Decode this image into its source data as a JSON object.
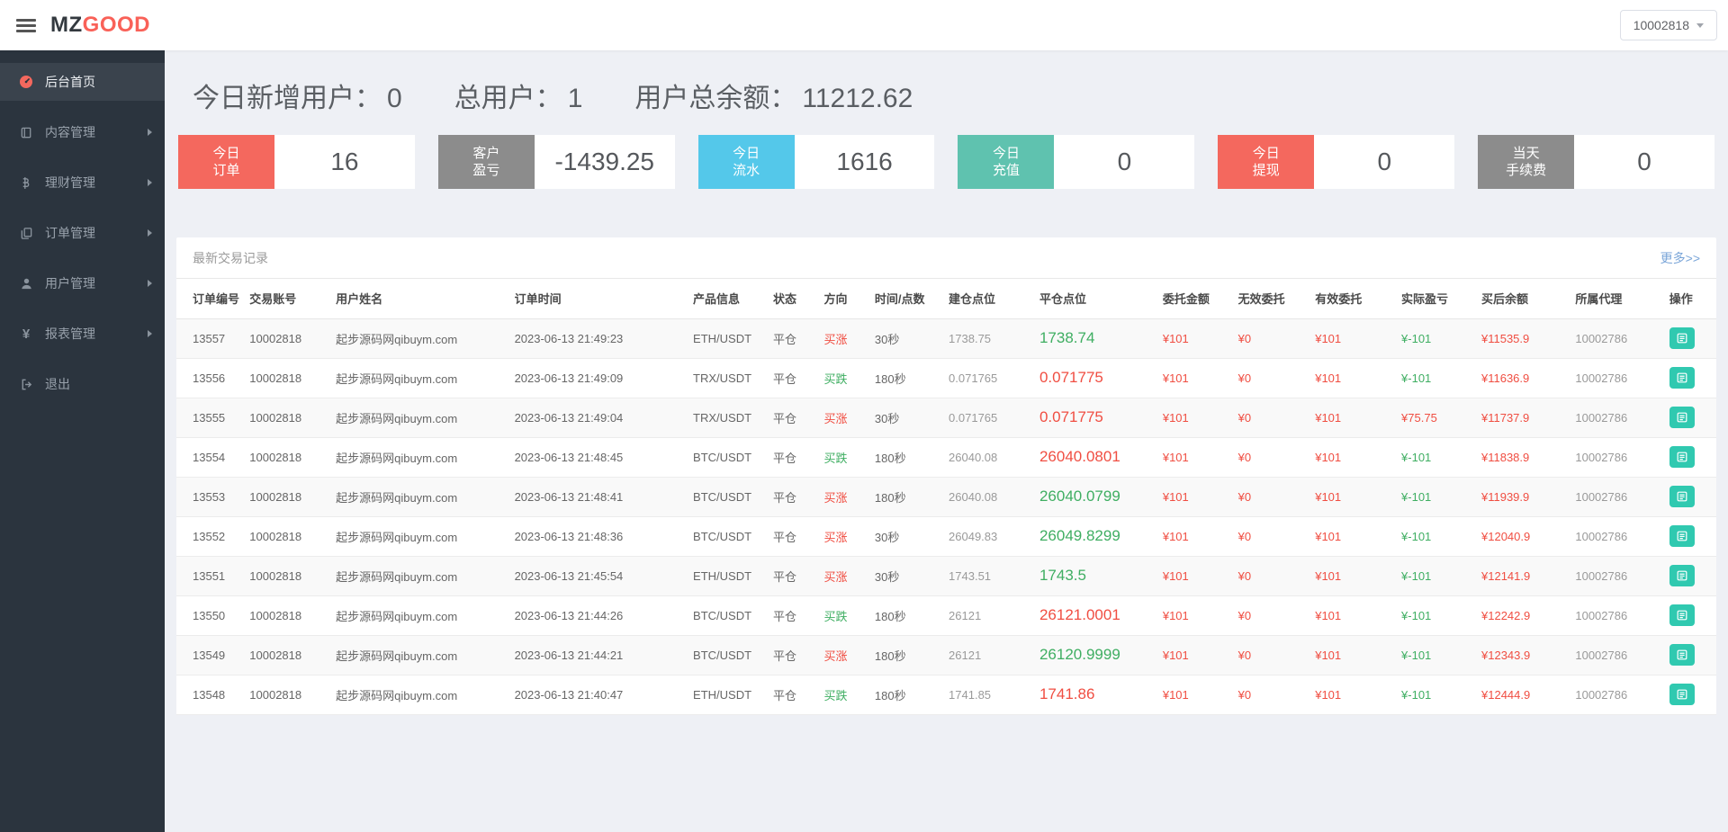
{
  "colors": {
    "brand_red": "#f96158",
    "card_red": "#f4685e",
    "card_gray": "#8c8c8c",
    "card_blue": "#54c8ea",
    "card_teal": "#5fc2af",
    "text_red": "#f04e42",
    "text_green": "#3fae62",
    "link_blue": "#7aa5d8",
    "action_teal": "#30c9b0",
    "sidebar_bg": "#2b343e"
  },
  "topbar": {
    "menu_icon": "menu-icon",
    "logo_prefix": "MZ",
    "logo_suffix": "GOOD",
    "account": "10002818",
    "account_caret_icon": "chevron-down-icon"
  },
  "sidebar": {
    "items": [
      {
        "name": "home",
        "label": "后台首页",
        "icon": "dashboard-icon",
        "active": true,
        "arrow": false
      },
      {
        "name": "content",
        "label": "内容管理",
        "icon": "book-icon",
        "active": false,
        "arrow": true
      },
      {
        "name": "finance",
        "label": "理财管理",
        "icon": "bitcoin-icon",
        "active": false,
        "arrow": true
      },
      {
        "name": "orders",
        "label": "订单管理",
        "icon": "copy-icon",
        "active": false,
        "arrow": true
      },
      {
        "name": "users",
        "label": "用户管理",
        "icon": "user-icon",
        "active": false,
        "arrow": true
      },
      {
        "name": "reports",
        "label": "报表管理",
        "icon": "yen-icon",
        "active": false,
        "arrow": true
      },
      {
        "name": "logout",
        "label": "退出",
        "icon": "logout-icon",
        "active": false,
        "arrow": false
      }
    ]
  },
  "summary": [
    {
      "label": "今日新增用户：",
      "value": "0"
    },
    {
      "label": "总用户：",
      "value": "1"
    },
    {
      "label": "用户总余额：",
      "value": "11212.62"
    }
  ],
  "cards": [
    {
      "lines": [
        "今日",
        "订单"
      ],
      "value": "16",
      "color": "#f4685e"
    },
    {
      "lines": [
        "客户",
        "盈亏"
      ],
      "value": "-1439.25",
      "color": "#8c8c8c"
    },
    {
      "lines": [
        "今日",
        "流水"
      ],
      "value": "1616",
      "color": "#54c8ea"
    },
    {
      "lines": [
        "今日",
        "充值"
      ],
      "value": "0",
      "color": "#5fc2af"
    },
    {
      "lines": [
        "今日",
        "提现"
      ],
      "value": "0",
      "color": "#f4685e"
    },
    {
      "lines": [
        "当天",
        "手续费"
      ],
      "value": "0",
      "color": "#8c8c8c"
    }
  ],
  "panel": {
    "title": "最新交易记录",
    "more_link": "更多>>"
  },
  "table": {
    "columns": [
      "订单编号",
      "交易账号",
      "用户姓名",
      "订单时间",
      "产品信息",
      "状态",
      "方向",
      "时间/点数",
      "建仓点位",
      "平仓点位",
      "委托金额",
      "无效委托",
      "有效委托",
      "实际盈亏",
      "买后余额",
      "所属代理",
      "操作"
    ],
    "action_icon": "list-icon",
    "rows": [
      {
        "order_no": "13557",
        "account": "10002818",
        "username": "起步源码网qibuym.com",
        "time": "2023-06-13 21:49:23",
        "product": "ETH/USDT",
        "status": "平仓",
        "direction": "买涨",
        "direction_color": "red",
        "duration": "30秒",
        "open_point": "1738.75",
        "close_point": "1738.74",
        "close_color": "green",
        "entrust": "¥101",
        "invalid": "¥0",
        "valid": "¥101",
        "profit": "¥-101",
        "profit_color": "green",
        "balance": "¥11535.9",
        "agent": "10002786"
      },
      {
        "order_no": "13556",
        "account": "10002818",
        "username": "起步源码网qibuym.com",
        "time": "2023-06-13 21:49:09",
        "product": "TRX/USDT",
        "status": "平仓",
        "direction": "买跌",
        "direction_color": "green",
        "duration": "180秒",
        "open_point": "0.071765",
        "close_point": "0.071775",
        "close_color": "red",
        "entrust": "¥101",
        "invalid": "¥0",
        "valid": "¥101",
        "profit": "¥-101",
        "profit_color": "green",
        "balance": "¥11636.9",
        "agent": "10002786"
      },
      {
        "order_no": "13555",
        "account": "10002818",
        "username": "起步源码网qibuym.com",
        "time": "2023-06-13 21:49:04",
        "product": "TRX/USDT",
        "status": "平仓",
        "direction": "买涨",
        "direction_color": "red",
        "duration": "30秒",
        "open_point": "0.071765",
        "close_point": "0.071775",
        "close_color": "red",
        "entrust": "¥101",
        "invalid": "¥0",
        "valid": "¥101",
        "profit": "¥75.75",
        "profit_color": "red",
        "balance": "¥11737.9",
        "agent": "10002786"
      },
      {
        "order_no": "13554",
        "account": "10002818",
        "username": "起步源码网qibuym.com",
        "time": "2023-06-13 21:48:45",
        "product": "BTC/USDT",
        "status": "平仓",
        "direction": "买跌",
        "direction_color": "green",
        "duration": "180秒",
        "open_point": "26040.08",
        "close_point": "26040.0801",
        "close_color": "red",
        "entrust": "¥101",
        "invalid": "¥0",
        "valid": "¥101",
        "profit": "¥-101",
        "profit_color": "green",
        "balance": "¥11838.9",
        "agent": "10002786"
      },
      {
        "order_no": "13553",
        "account": "10002818",
        "username": "起步源码网qibuym.com",
        "time": "2023-06-13 21:48:41",
        "product": "BTC/USDT",
        "status": "平仓",
        "direction": "买涨",
        "direction_color": "red",
        "duration": "180秒",
        "open_point": "26040.08",
        "close_point": "26040.0799",
        "close_color": "green",
        "entrust": "¥101",
        "invalid": "¥0",
        "valid": "¥101",
        "profit": "¥-101",
        "profit_color": "green",
        "balance": "¥11939.9",
        "agent": "10002786"
      },
      {
        "order_no": "13552",
        "account": "10002818",
        "username": "起步源码网qibuym.com",
        "time": "2023-06-13 21:48:36",
        "product": "BTC/USDT",
        "status": "平仓",
        "direction": "买涨",
        "direction_color": "red",
        "duration": "30秒",
        "open_point": "26049.83",
        "close_point": "26049.8299",
        "close_color": "green",
        "entrust": "¥101",
        "invalid": "¥0",
        "valid": "¥101",
        "profit": "¥-101",
        "profit_color": "green",
        "balance": "¥12040.9",
        "agent": "10002786"
      },
      {
        "order_no": "13551",
        "account": "10002818",
        "username": "起步源码网qibuym.com",
        "time": "2023-06-13 21:45:54",
        "product": "ETH/USDT",
        "status": "平仓",
        "direction": "买涨",
        "direction_color": "red",
        "duration": "30秒",
        "open_point": "1743.51",
        "close_point": "1743.5",
        "close_color": "green",
        "entrust": "¥101",
        "invalid": "¥0",
        "valid": "¥101",
        "profit": "¥-101",
        "profit_color": "green",
        "balance": "¥12141.9",
        "agent": "10002786"
      },
      {
        "order_no": "13550",
        "account": "10002818",
        "username": "起步源码网qibuym.com",
        "time": "2023-06-13 21:44:26",
        "product": "BTC/USDT",
        "status": "平仓",
        "direction": "买跌",
        "direction_color": "green",
        "duration": "180秒",
        "open_point": "26121",
        "close_point": "26121.0001",
        "close_color": "red",
        "entrust": "¥101",
        "invalid": "¥0",
        "valid": "¥101",
        "profit": "¥-101",
        "profit_color": "green",
        "balance": "¥12242.9",
        "agent": "10002786"
      },
      {
        "order_no": "13549",
        "account": "10002818",
        "username": "起步源码网qibuym.com",
        "time": "2023-06-13 21:44:21",
        "product": "BTC/USDT",
        "status": "平仓",
        "direction": "买涨",
        "direction_color": "red",
        "duration": "180秒",
        "open_point": "26121",
        "close_point": "26120.9999",
        "close_color": "green",
        "entrust": "¥101",
        "invalid": "¥0",
        "valid": "¥101",
        "profit": "¥-101",
        "profit_color": "green",
        "balance": "¥12343.9",
        "agent": "10002786"
      },
      {
        "order_no": "13548",
        "account": "10002818",
        "username": "起步源码网qibuym.com",
        "time": "2023-06-13 21:40:47",
        "product": "ETH/USDT",
        "status": "平仓",
        "direction": "买跌",
        "direction_color": "green",
        "duration": "180秒",
        "open_point": "1741.85",
        "close_point": "1741.86",
        "close_color": "red",
        "entrust": "¥101",
        "invalid": "¥0",
        "valid": "¥101",
        "profit": "¥-101",
        "profit_color": "green",
        "balance": "¥12444.9",
        "agent": "10002786"
      }
    ]
  }
}
